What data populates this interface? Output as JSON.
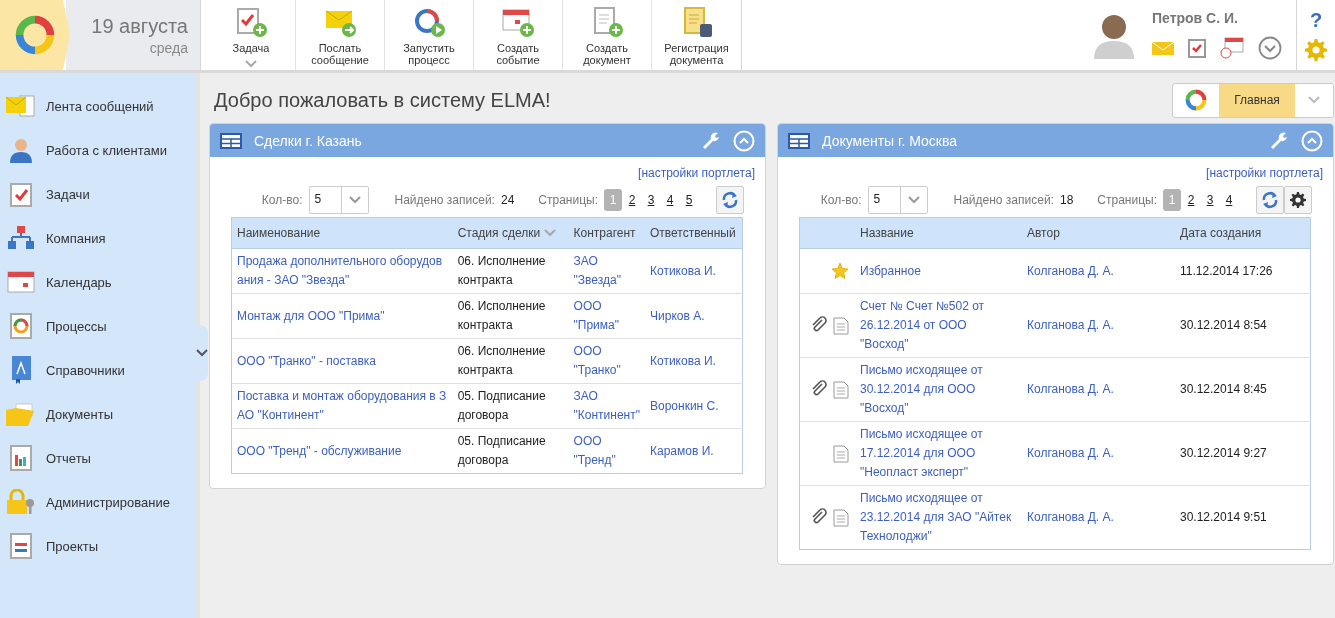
{
  "header": {
    "date": "19 августа",
    "weekday": "среда",
    "toolbar": [
      {
        "label": "Задача",
        "dropdown": true
      },
      {
        "label": "Послать сообщение",
        "dropdown": false
      },
      {
        "label": "Запустить процесс",
        "dropdown": false
      },
      {
        "label": "Создать событие",
        "dropdown": false
      },
      {
        "label": "Создать документ",
        "dropdown": false
      },
      {
        "label": "Регистрация документа",
        "dropdown": false
      }
    ],
    "user": {
      "name": "Петров С. И."
    },
    "help": "?"
  },
  "sidebar": {
    "items": [
      {
        "label": "Лента сообщений"
      },
      {
        "label": "Работа с клиентами"
      },
      {
        "label": "Задачи"
      },
      {
        "label": "Компания"
      },
      {
        "label": "Календарь"
      },
      {
        "label": "Процессы"
      },
      {
        "label": "Справочники"
      },
      {
        "label": "Документы"
      },
      {
        "label": "Отчеты"
      },
      {
        "label": "Администрирование"
      },
      {
        "label": "Проекты"
      }
    ]
  },
  "page": {
    "title": "Добро пожаловать в систему ELMA!",
    "home_button": "Главная"
  },
  "portlets": [
    {
      "title": "Сделки г. Казань",
      "settings_link": "[настройки портлета]",
      "count_label": "Кол-во:",
      "count_value": "5",
      "found_label": "Найдено записей:",
      "found_value": "24",
      "pages_label": "Страницы:",
      "pages": [
        {
          "label": "1",
          "selected": true
        },
        {
          "label": "2",
          "selected": false
        },
        {
          "label": "3",
          "selected": false
        },
        {
          "label": "4",
          "selected": false
        },
        {
          "label": "5",
          "selected": false
        }
      ],
      "gear_button": false,
      "table": {
        "kind": "deals",
        "columns": [
          {
            "label": "Наименование",
            "sorted": false
          },
          {
            "label": "Стадия сделки",
            "sorted": true
          },
          {
            "label": "Контрагент",
            "sorted": false
          },
          {
            "label": "Ответственный",
            "sorted": false
          }
        ],
        "rows": [
          {
            "cells": [
              "Продажа дополнительного оборудов ания - ЗАО \"Звезда\"",
              "06. Исполнение контракта",
              "ЗАО \"Звезда\"",
              "Котикова И."
            ]
          },
          {
            "cells": [
              "Монтаж для ООО \"Прима\"",
              "06. Исполнение контракта",
              "ООО \"Прима\"",
              "Чирков А."
            ]
          },
          {
            "cells": [
              "ООО \"Транко\" - поставка",
              "06. Исполнение контракта",
              "ООО \"Транко\"",
              "Котикова И."
            ]
          },
          {
            "cells": [
              "Поставка и монтаж оборудования в З АО \"Континент\"",
              "05. Подписание договора",
              "ЗАО \"Континент\"",
              "Воронкин С."
            ]
          },
          {
            "cells": [
              "ООО \"Тренд\" - обслуживание",
              "05. Подписание договора",
              "ООО \"Тренд\"",
              "Карамов И."
            ]
          }
        ]
      }
    },
    {
      "title": "Документы г. Москва",
      "settings_link": "[настройки портлета]",
      "count_label": "Кол-во:",
      "count_value": "5",
      "found_label": "Найдено записей:",
      "found_value": "18",
      "pages_label": "Страницы:",
      "pages": [
        {
          "label": "1",
          "selected": true
        },
        {
          "label": "2",
          "selected": false
        },
        {
          "label": "3",
          "selected": false
        },
        {
          "label": "4",
          "selected": false
        }
      ],
      "gear_button": true,
      "table": {
        "kind": "documents",
        "columns": [
          {
            "label": "Название",
            "sorted": false
          },
          {
            "label": "Автор",
            "sorted": false
          },
          {
            "label": "Дата создания",
            "sorted": false
          }
        ],
        "rows": [
          {
            "kind": "favorite",
            "attachment": false,
            "cells": [
              "Избранное",
              "Колганова Д. А.",
              "11.12.2014 17:26"
            ]
          },
          {
            "kind": "document",
            "attachment": true,
            "cells": [
              "Счет № Счет №502 от 26.12.2014 от ООО \"Восход\"",
              "Колганова Д. А.",
              "30.12.2014 8:54"
            ]
          },
          {
            "kind": "document",
            "attachment": true,
            "cells": [
              "Письмо исходящее от 30.12.2014 для ООО \"Восход\"",
              "Колганова Д. А.",
              "30.12.2014 8:45"
            ]
          },
          {
            "kind": "document",
            "attachment": false,
            "cells": [
              "Письмо исходящее от 17.12.2014 для ООО \"Неопласт эксперт\"",
              "Колганова Д. А.",
              "30.12.2014 9:27"
            ]
          },
          {
            "kind": "document",
            "attachment": true,
            "cells": [
              "Письмо исходящее от 23.12.2014 для ЗАО \"Айтек Технолоджи\"",
              "Колганова Д. А.",
              "30.12.2014 9:51"
            ]
          }
        ]
      }
    }
  ]
}
